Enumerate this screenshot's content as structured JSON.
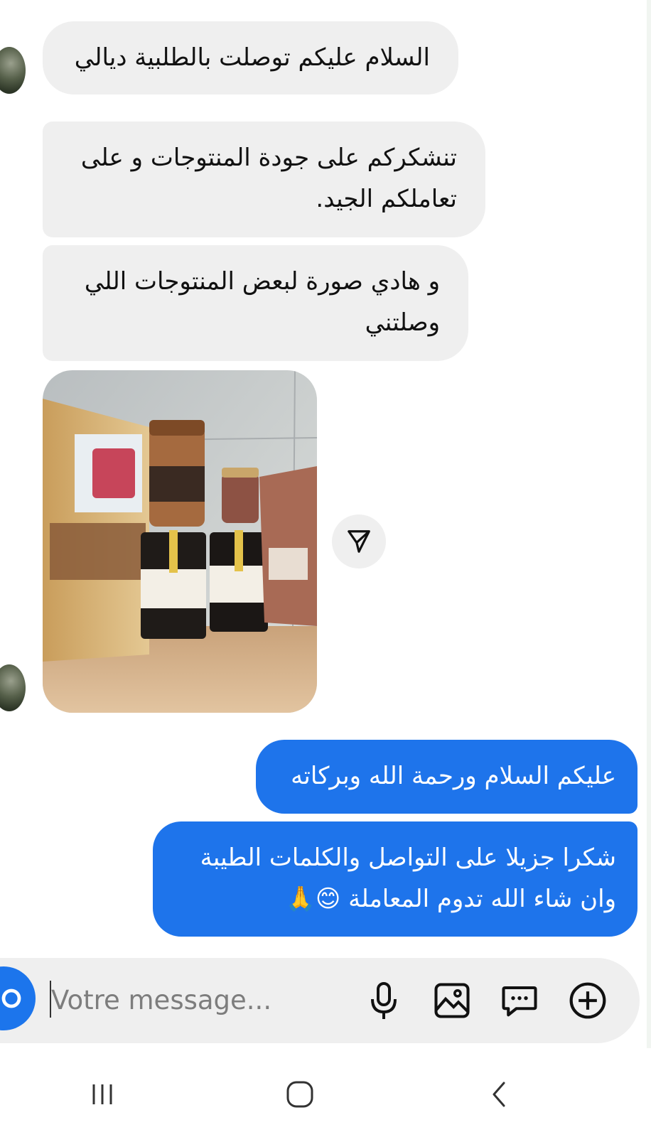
{
  "conversation": {
    "incoming": [
      {
        "text": "السلام عليكم توصلت بالطلبية ديالي"
      },
      {
        "text": "تنشكركم على جودة المنتوجات و على\nتعاملكم الجيد."
      },
      {
        "text": "و هادي صورة لبعض المنتوجات اللي\nوصلتني"
      }
    ],
    "outgoing": [
      {
        "text": "عليكم السلام ورحمة الله وبركاته"
      },
      {
        "text": "شكرا جزيلا على التواصل والكلمات الطيبة\nوان شاء الله تدوم المعاملة 😊🙏"
      }
    ]
  },
  "composer": {
    "placeholder": "Votre message...",
    "icons": [
      "camera-icon",
      "microphone-icon",
      "image-icon",
      "sticker-icon",
      "plus-circle-icon"
    ]
  },
  "share": {
    "icon": "paper-plane-icon"
  },
  "navbar": {
    "icons": [
      "recent-apps-icon",
      "home-icon",
      "back-icon"
    ]
  },
  "colors": {
    "incoming_bubble": "#efefef",
    "outgoing_bubble": "#1e74eb",
    "accent": "#1c75ec"
  }
}
